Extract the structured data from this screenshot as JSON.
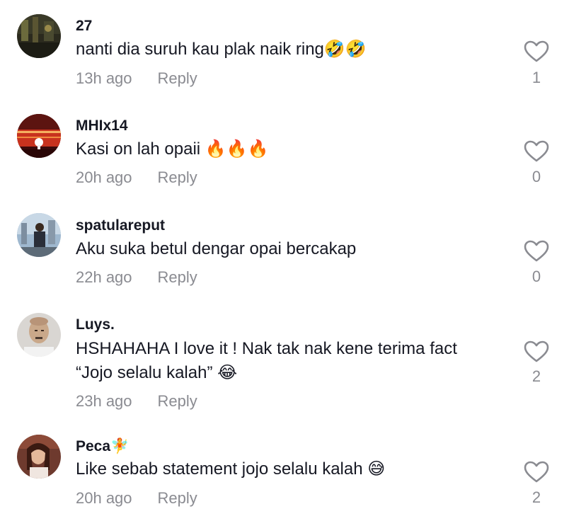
{
  "comments": [
    {
      "username": "27",
      "text": "nanti dia suruh kau plak naik ring🤣🤣",
      "time": "13h ago",
      "reply_label": "Reply",
      "likes": "1"
    },
    {
      "username": "MHIx14",
      "text": "Kasi on lah opaii 🔥🔥🔥",
      "time": "20h ago",
      "reply_label": "Reply",
      "likes": "0"
    },
    {
      "username": "spatulareput",
      "text": "Aku suka betul dengar opai bercakap",
      "time": "22h ago",
      "reply_label": "Reply",
      "likes": "0"
    },
    {
      "username": "Luys.",
      "text": "HSHAHAHA I love it ! Nak tak nak kene terima fact\n“Jojo selalu kalah” 😂",
      "time": "23h ago",
      "reply_label": "Reply",
      "likes": "2"
    },
    {
      "username": "Peca🧚",
      "text": "Like sebab statement jojo selalu kalah 😅",
      "time": "20h ago",
      "reply_label": "Reply",
      "likes": "2"
    }
  ],
  "colors": {
    "text": "#161823",
    "secondary": "#8a8b91",
    "background": "#ffffff"
  },
  "icons": {
    "like": "heart-outline-icon"
  }
}
